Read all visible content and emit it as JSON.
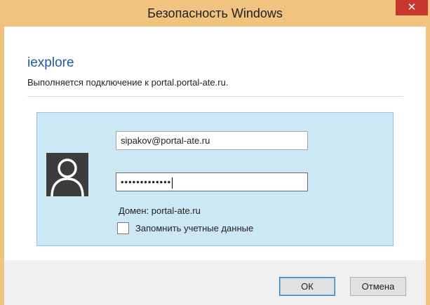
{
  "window": {
    "title": "Безопасность Windows",
    "close_glyph": "✕"
  },
  "header": {
    "app_name": "iexplore",
    "message": "Выполняется подключение к portal.portal-ate.ru."
  },
  "credentials": {
    "avatar_icon": "user-silhouette-icon",
    "username_value": "sipakov@portal-ate.ru",
    "password_masked": "•••••••••••••",
    "domain_label": "Домен: portal-ate.ru",
    "remember_label": "Запомнить учетные данные",
    "remember_checked": false
  },
  "buttons": {
    "ok_label": "ОК",
    "cancel_label": "Отмена"
  },
  "colors": {
    "titlebar": "#f0c47f",
    "close": "#c7372f",
    "panel": "#cce8f5",
    "accent_text": "#1e5aa8"
  }
}
